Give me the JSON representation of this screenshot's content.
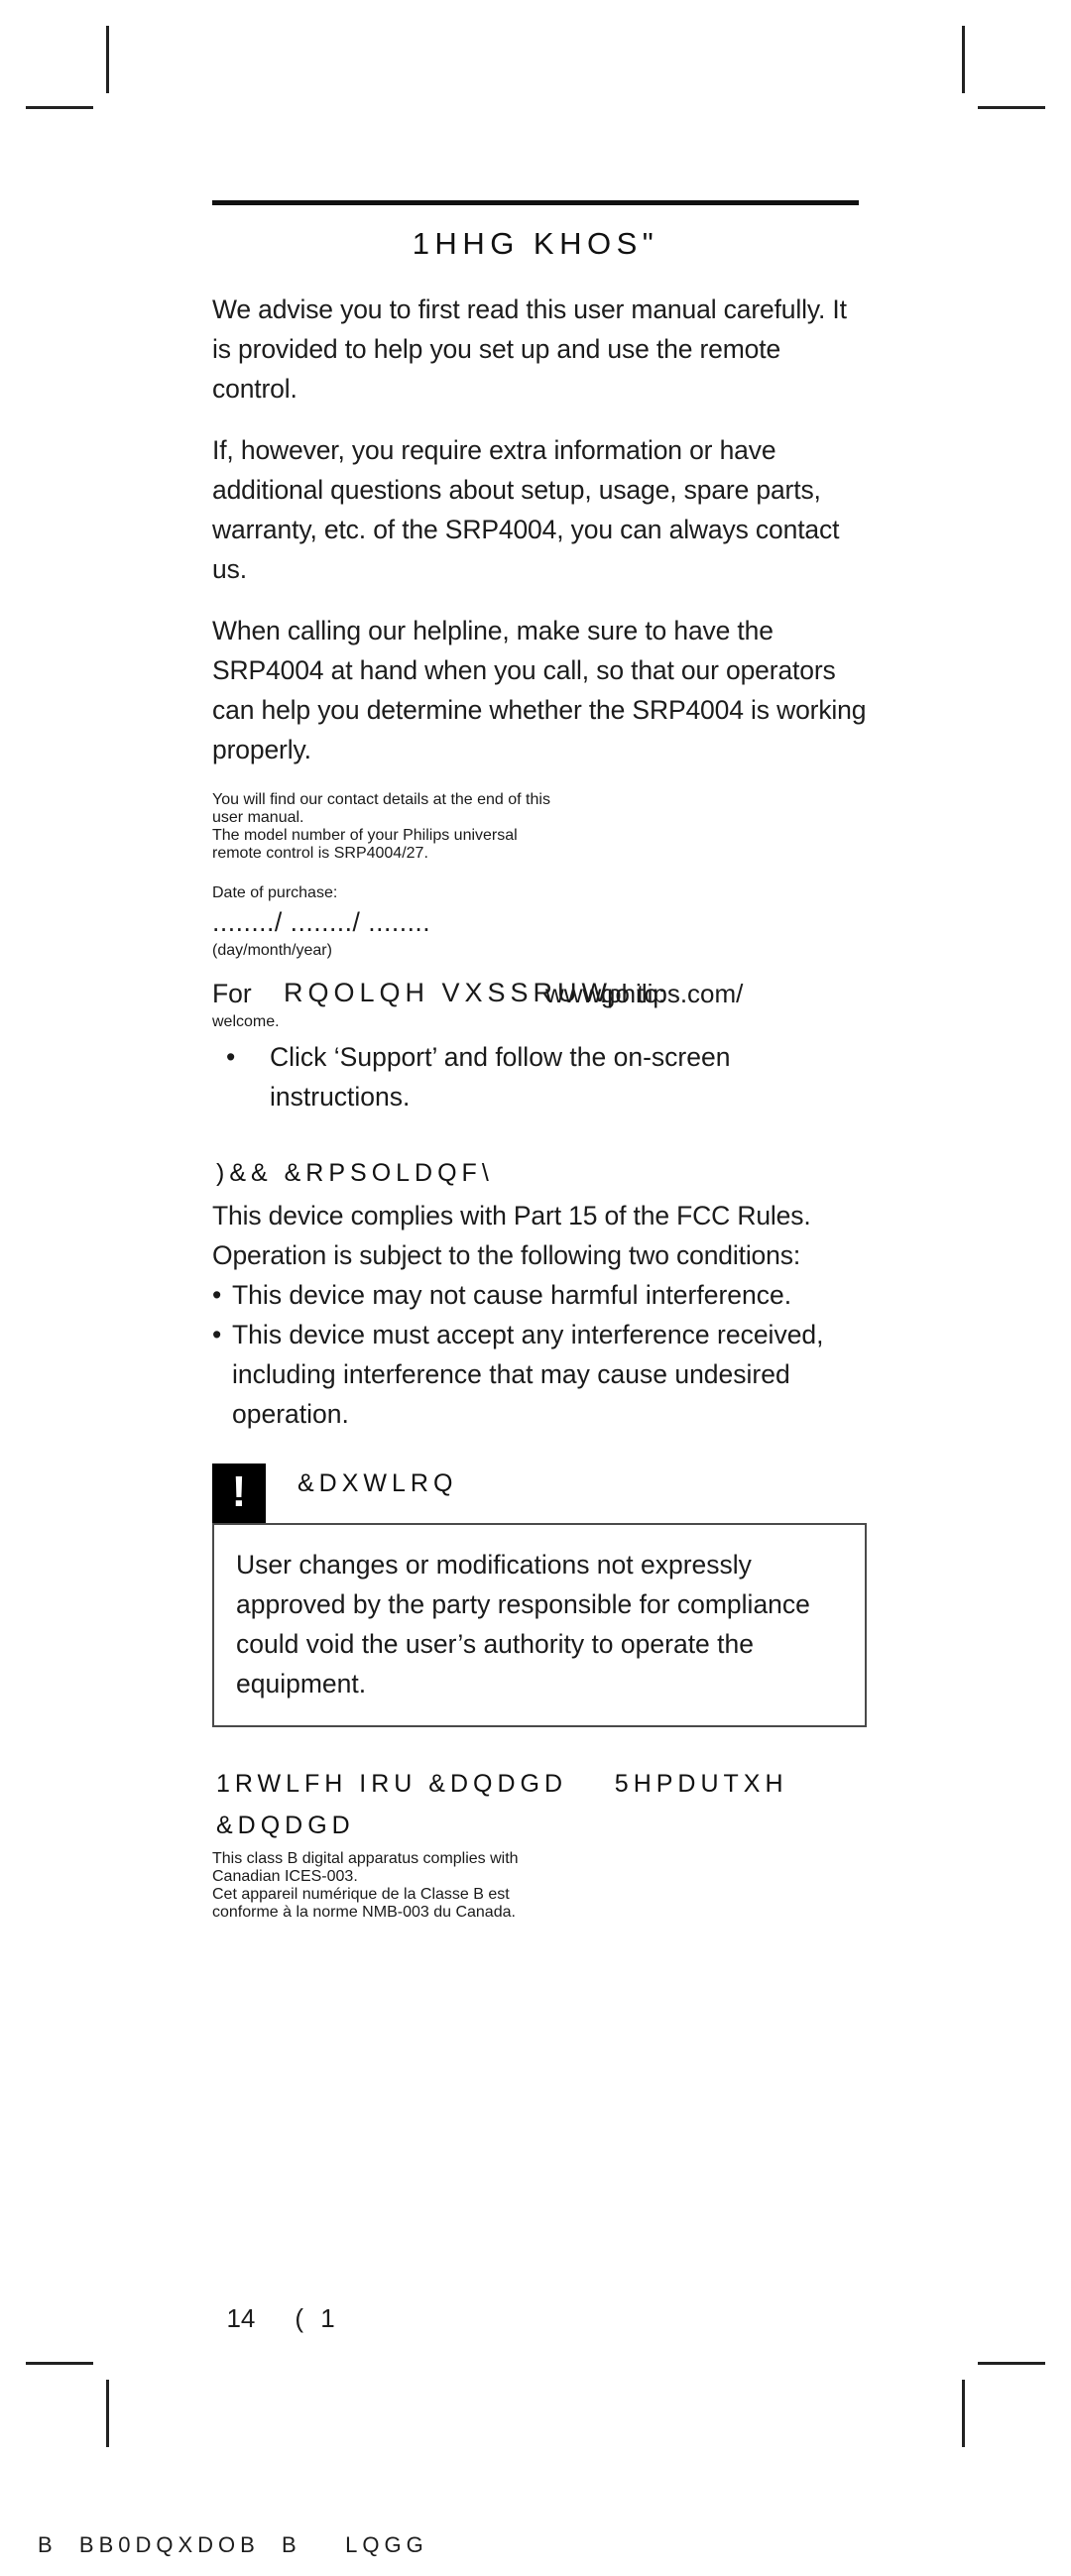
{
  "document": {
    "title_encoded": "1HHG KHOS\"",
    "page_number": "14",
    "page_footer_code": "( 1",
    "file_stamp": "B  BB0DQXDOB  B    LQGG"
  },
  "intro": {
    "paragraph_1": "We advise you to first read this user manual carefully. It is provided to help you set up and use the remote control.",
    "paragraph_2": "If, however, you require extra information or have additional questions about setup, usage, spare parts, warranty, etc. of the SRP4004, you can always contact us.",
    "paragraph_3": "When calling our helpline, make sure to have the SRP4004 at hand when you call, so that our operators can help you determine whether the SRP4004 is working properly.",
    "paragraph_4_line_1": "You will find our contact details at the end of this",
    "paragraph_4_line_2": "user manual.",
    "paragraph_4_line_3": "The model number of your Philips universal",
    "paragraph_4_line_4": "remote control is SRP4004/27."
  },
  "purchase": {
    "label": "Date of purchase:",
    "blank_line": "......../ ......../ ........",
    "format_hint": "(day/month/year)"
  },
  "support": {
    "lead": "For",
    "encoded_phrase": "RQOLQH VXSSRUW",
    "url_overlay": "www.philips.com/",
    "goto_overlay": "go to:",
    "trailing": "welcome.",
    "bullets": [
      "Click ‘Support’ and follow the on-screen instructions."
    ]
  },
  "fcc": {
    "heading_encoded": ")&& &RPSOLDQF\\",
    "intro": "This device complies with Part 15 of the FCC Rules. Operation is subject to the following two conditions:",
    "conditions": [
      "This device may not cause harmful interference.",
      "This device must accept any interference received, including interference that may cause undesired operation."
    ]
  },
  "caution": {
    "icon_glyph": "!",
    "heading_encoded": "&DXWLRQ",
    "body": "User changes or modifications not expressly approved by the party responsible for compliance could void the user’s authority to operate the equipment."
  },
  "canada": {
    "heading_encoded": "1RWLFH IRU &DQDGD    5HPDUTXH\n&DQDGD",
    "line_1": "This class B digital apparatus complies with",
    "line_2": "Canadian ICES-003.",
    "line_3": "Cet appareil numérique de la Classe B est",
    "line_4": "conforme à la norme NMB-003 du Canada."
  }
}
